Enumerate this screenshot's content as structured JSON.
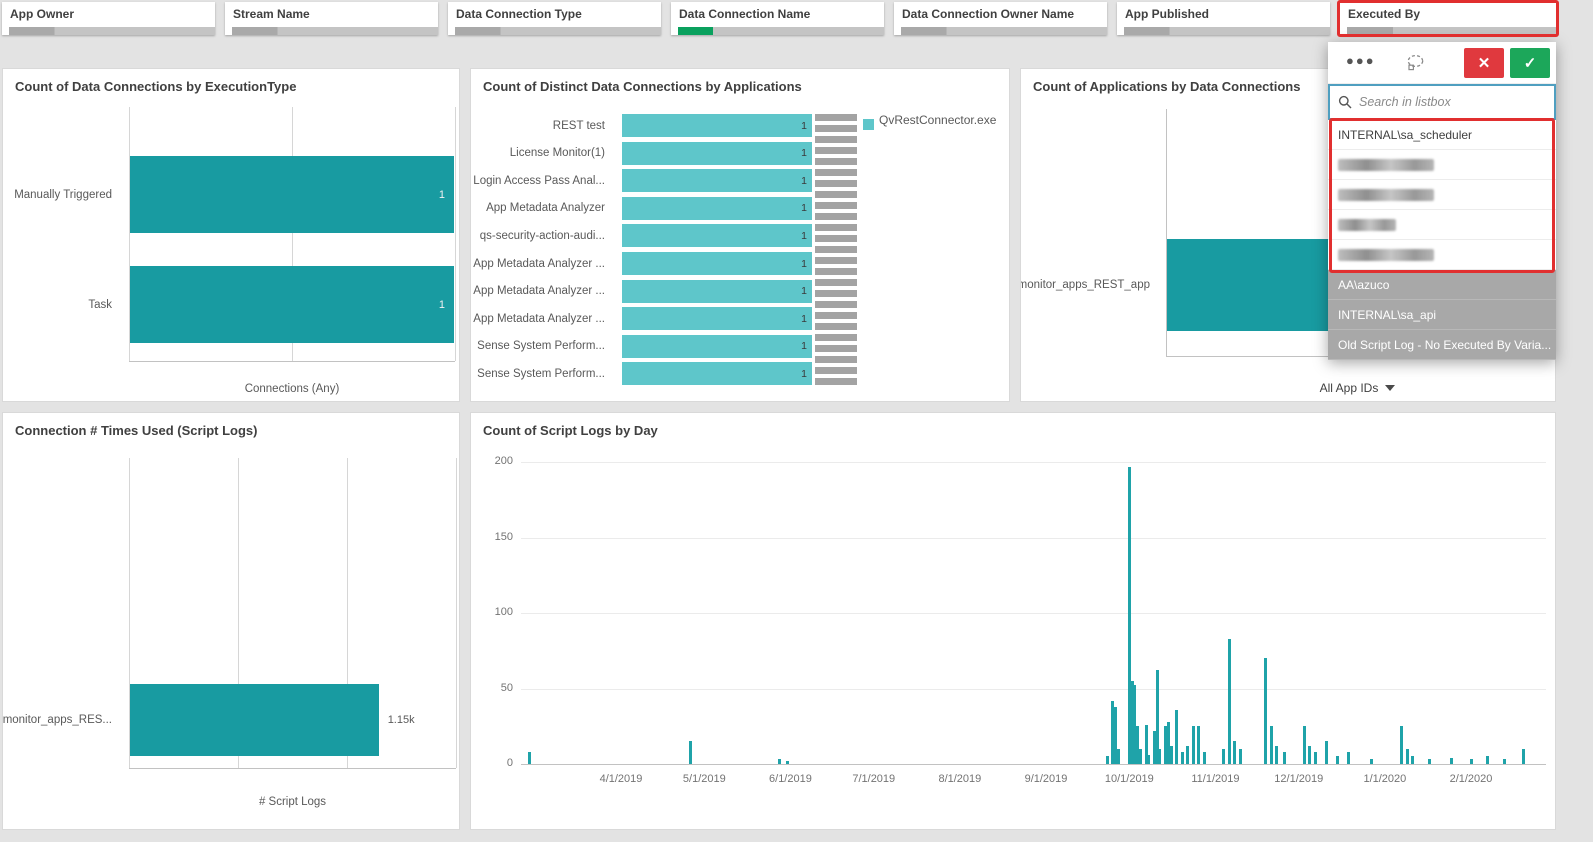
{
  "filter_bar": {
    "items": [
      {
        "label": "App Owner"
      },
      {
        "label": "Stream Name"
      },
      {
        "label": "Data Connection Type"
      },
      {
        "label": "Data Connection Name",
        "has_selection": true
      },
      {
        "label": "Data Connection Owner Name"
      },
      {
        "label": "App Published"
      },
      {
        "label": "Executed By",
        "highlighted": true
      }
    ]
  },
  "listbox": {
    "field": "Executed By",
    "search_placeholder": "Search in listbox",
    "rows": [
      {
        "text": "INTERNAL\\sa_scheduler",
        "state": "possible",
        "redacted": false
      },
      {
        "text": "",
        "state": "possible",
        "redacted": true
      },
      {
        "text": "",
        "state": "possible",
        "redacted": true
      },
      {
        "text": "",
        "state": "possible",
        "redacted": true
      },
      {
        "text": "",
        "state": "possible",
        "redacted": true
      },
      {
        "text": "AA\\azuco",
        "state": "excluded",
        "redacted": false
      },
      {
        "text": "INTERNAL\\sa_api",
        "state": "excluded",
        "redacted": false
      },
      {
        "text": "Old Script Log - No Executed By Varia...",
        "state": "excluded",
        "redacted": false
      }
    ]
  },
  "colors": {
    "teal_dark": "#189ba1",
    "teal_light": "#5ec6ca",
    "teal_day": "#1fa3a9",
    "annotation_red": "#e12f2f",
    "cancel_red": "#e0393e",
    "confirm_green": "#1ca75a"
  },
  "chart_data": [
    {
      "id": "exec_type",
      "type": "bar",
      "orientation": "horizontal",
      "title": "Count of Data Connections by ExecutionType",
      "categories": [
        "Manually Triggered",
        "Task"
      ],
      "values": [
        1,
        1
      ],
      "value_labels": [
        "1",
        "1"
      ],
      "xlabel": "Connections (Any)",
      "xlim": [
        0,
        1
      ],
      "grid_fractions": [
        0,
        0.5,
        1
      ],
      "bar_color": "#189ba1"
    },
    {
      "id": "distinct_conn",
      "type": "bar",
      "orientation": "horizontal",
      "title": "Count of Distinct Data Connections by Applications",
      "categories": [
        "REST test",
        "License Monitor(1)",
        "Login Access Pass Anal...",
        "App Metadata Analyzer",
        "qs-security-action-audi...",
        "App Metadata Analyzer ...",
        "App Metadata Analyzer ...",
        "App Metadata Analyzer ...",
        "Sense System Perform...",
        "Sense System Perform..."
      ],
      "values": [
        1,
        1,
        1,
        1,
        1,
        1,
        1,
        1,
        1,
        1
      ],
      "value_labels": [
        "1",
        "1",
        "1",
        "1",
        "1",
        "1",
        "1",
        "1",
        "1",
        "1"
      ],
      "xlim": [
        0,
        1
      ],
      "bar_color": "#5ec6ca",
      "legend": [
        {
          "label": "QvRestConnector.exe",
          "color": "#5ec6ca"
        }
      ],
      "overflow_scrollbar": true
    },
    {
      "id": "apps_by_conn",
      "type": "bar",
      "orientation": "horizontal",
      "title": "Count of Applications by Data Connections",
      "categories": [
        "monitor_apps_REST_app"
      ],
      "values": [
        null
      ],
      "value_labels": [
        ""
      ],
      "bar_color": "#189ba1",
      "footer": "All App IDs",
      "occluded_by_popup": true
    },
    {
      "id": "times_used",
      "type": "bar",
      "orientation": "horizontal",
      "title": "Connection # Times Used (Script Logs)",
      "categories": [
        "monitor_apps_RES..."
      ],
      "values": [
        1150
      ],
      "value_labels": [
        "1.15k"
      ],
      "xlabel": "# Script Logs",
      "xlim": [
        0,
        1500
      ],
      "grid_fractions": [
        0,
        0.3333,
        0.6667,
        1
      ],
      "bar_color": "#189ba1"
    },
    {
      "id": "logs_by_day",
      "type": "bar",
      "orientation": "vertical",
      "title": "Count of Script Logs by Day",
      "ylim": [
        0,
        200
      ],
      "yticks": [
        0,
        50,
        100,
        150,
        200
      ],
      "xticks": [
        "4/1/2019",
        "5/1/2019",
        "6/1/2019",
        "7/1/2019",
        "8/1/2019",
        "9/1/2019",
        "10/1/2019",
        "11/1/2019",
        "12/1/2019",
        "1/1/2020",
        "2/1/2020"
      ],
      "x_domain": [
        "2019-02-24",
        "2020-02-28"
      ],
      "bar_color": "#1fa3a9",
      "points": [
        [
          "2019-02-27",
          8
        ],
        [
          "2019-04-26",
          15
        ],
        [
          "2019-05-28",
          3
        ],
        [
          "2019-05-31",
          2
        ],
        [
          "2019-09-23",
          5
        ],
        [
          "2019-09-25",
          42
        ],
        [
          "2019-09-26",
          38
        ],
        [
          "2019-09-27",
          10
        ],
        [
          "2019-10-01",
          197
        ],
        [
          "2019-10-02",
          55
        ],
        [
          "2019-10-03",
          52
        ],
        [
          "2019-10-04",
          25
        ],
        [
          "2019-10-05",
          10
        ],
        [
          "2019-10-07",
          26
        ],
        [
          "2019-10-08",
          6
        ],
        [
          "2019-10-10",
          22
        ],
        [
          "2019-10-11",
          62
        ],
        [
          "2019-10-12",
          10
        ],
        [
          "2019-10-14",
          25
        ],
        [
          "2019-10-15",
          28
        ],
        [
          "2019-10-16",
          12
        ],
        [
          "2019-10-18",
          36
        ],
        [
          "2019-10-20",
          8
        ],
        [
          "2019-10-22",
          12
        ],
        [
          "2019-10-24",
          25
        ],
        [
          "2019-10-26",
          25
        ],
        [
          "2019-10-28",
          8
        ],
        [
          "2019-11-04",
          10
        ],
        [
          "2019-11-06",
          83
        ],
        [
          "2019-11-08",
          15
        ],
        [
          "2019-11-10",
          10
        ],
        [
          "2019-11-19",
          70
        ],
        [
          "2019-11-21",
          25
        ],
        [
          "2019-11-23",
          12
        ],
        [
          "2019-11-26",
          8
        ],
        [
          "2019-12-03",
          25
        ],
        [
          "2019-12-05",
          12
        ],
        [
          "2019-12-07",
          8
        ],
        [
          "2019-12-11",
          15
        ],
        [
          "2019-12-15",
          5
        ],
        [
          "2019-12-19",
          8
        ],
        [
          "2019-12-27",
          3
        ],
        [
          "2020-01-07",
          25
        ],
        [
          "2020-01-09",
          10
        ],
        [
          "2020-01-11",
          5
        ],
        [
          "2020-01-17",
          3
        ],
        [
          "2020-01-25",
          4
        ],
        [
          "2020-02-01",
          3
        ],
        [
          "2020-02-07",
          5
        ],
        [
          "2020-02-13",
          3
        ],
        [
          "2020-02-20",
          10
        ]
      ]
    }
  ]
}
